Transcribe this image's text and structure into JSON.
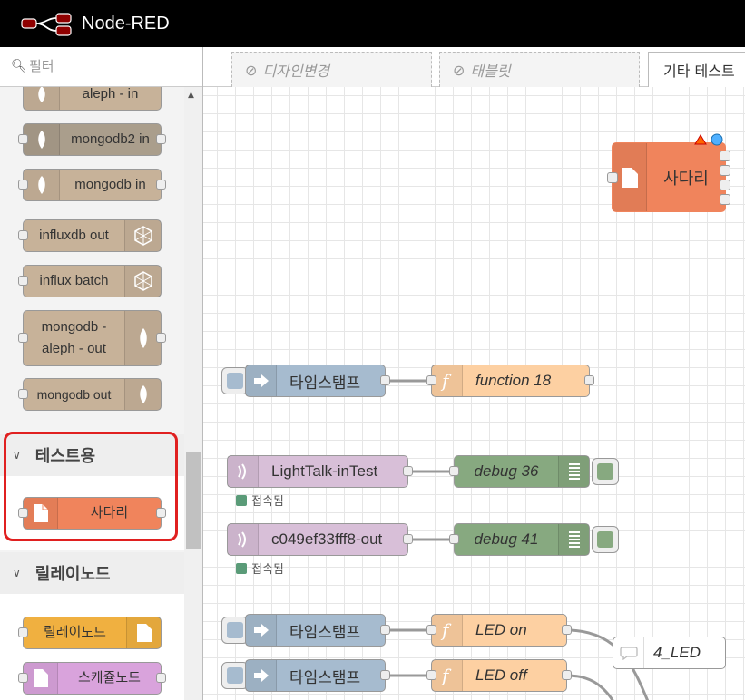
{
  "header": {
    "title": "Node-RED"
  },
  "palette": {
    "filter_placeholder": "필터",
    "nodes_top": [
      {
        "label": "aleph - in"
      },
      {
        "label": "mongodb2 in"
      },
      {
        "label": "mongodb in"
      },
      {
        "label": "influxdb out"
      },
      {
        "label": "influx batch"
      },
      {
        "label": "mongodb - aleph - out"
      },
      {
        "label": "mongodb out"
      }
    ],
    "categories": [
      {
        "title": "테스트용",
        "nodes": [
          {
            "label": "사다리"
          }
        ]
      },
      {
        "title": "릴레이노드",
        "nodes": [
          {
            "label": "릴레이노드"
          },
          {
            "label": "스케쥴노드"
          }
        ]
      }
    ]
  },
  "tabs": [
    {
      "label": "디자인변경",
      "disabled": true
    },
    {
      "label": "태블릿",
      "disabled": true
    },
    {
      "label": "기타 테스트",
      "disabled": false
    }
  ],
  "flow": {
    "sadari": {
      "label": "사다리"
    },
    "inject1": {
      "label": "타임스탬프"
    },
    "function18": {
      "label": "function 18"
    },
    "lighttalk": {
      "label": "LightTalk-inTest",
      "status": "접속됨"
    },
    "debug36": {
      "label": "debug 36"
    },
    "c049": {
      "label": "c049ef33fff8-out",
      "status": "접속됨"
    },
    "debug41": {
      "label": "debug 41"
    },
    "inject2": {
      "label": "타임스탬프"
    },
    "ledon": {
      "label": "LED on"
    },
    "comment": {
      "label": "4_LED"
    },
    "inject3": {
      "label": "타임스탬프"
    },
    "ledoff": {
      "label": "LED off"
    }
  },
  "colors": {
    "header_bg": "#000000",
    "storage_node": "#c7b299",
    "mongodb2_node": "#aa9e8c",
    "test_node": "#f0845c",
    "relay_node": "#f0b040",
    "schedule_node": "#d9a3dc",
    "inject_node": "#a6bbcf",
    "function_node": "#fdd0a2",
    "websocket_node": "#d8bfd8",
    "debug_node": "#87a980",
    "highlight_outline": "#e02020"
  }
}
